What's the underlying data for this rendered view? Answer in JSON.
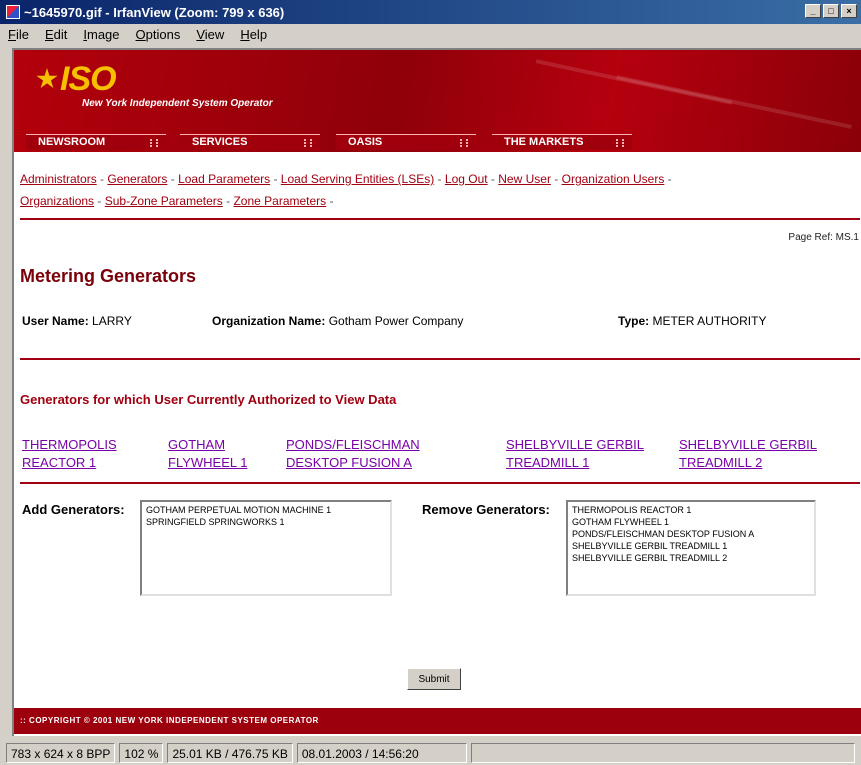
{
  "window": {
    "title": "~1645970.gif - IrfanView (Zoom: 799 x 636)",
    "menu": [
      "File",
      "Edit",
      "Image",
      "Options",
      "View",
      "Help"
    ]
  },
  "banner": {
    "logo": "ISO",
    "subtitle": "New York Independent System Operator",
    "tabs": [
      "NEWSROOM",
      "SERVICES",
      "OASIS",
      "THE MARKETS"
    ]
  },
  "nav_links": {
    "row1": [
      "Administrators",
      "Generators",
      "Load Parameters",
      "Load Serving Entities (LSEs)",
      "Log Out",
      "New User",
      "Organization Users"
    ],
    "row2": [
      "Organizations",
      "Sub-Zone Parameters",
      "Zone Parameters"
    ]
  },
  "page": {
    "page_ref": "Page Ref: MS.1",
    "title": "Metering Generators",
    "user_name_label": "User Name:",
    "user_name": "LARRY",
    "org_name_label": "Organization Name:",
    "org_name": "Gotham Power Company",
    "type_label": "Type:",
    "type": "METER AUTHORITY",
    "authorized_heading": "Generators for which User Currently Authorized to View Data",
    "authorized_generators": [
      {
        "line1": "THERMOPOLIS",
        "line2": "REACTOR 1"
      },
      {
        "line1": "GOTHAM",
        "line2": "FLYWHEEL 1"
      },
      {
        "line1": "PONDS/FLEISCHMAN",
        "line2": "DESKTOP FUSION A"
      },
      {
        "line1": "SHELBYVILLE GERBIL",
        "line2": "TREADMILL 1"
      },
      {
        "line1": "SHELBYVILLE GERBIL",
        "line2": "TREADMILL 2"
      }
    ],
    "add_label": "Add Generators:",
    "add_options": [
      "GOTHAM PERPETUAL MOTION MACHINE 1",
      "SPRINGFIELD SPRINGWORKS 1"
    ],
    "remove_label": "Remove Generators:",
    "remove_options": [
      "THERMOPOLIS REACTOR 1",
      "GOTHAM FLYWHEEL 1",
      "PONDS/FLEISCHMAN DESKTOP FUSION A",
      "SHELBYVILLE GERBIL TREADMILL 1",
      "SHELBYVILLE GERBIL TREADMILL 2"
    ],
    "submit_label": "Submit",
    "footer": ":: COPYRIGHT © 2001 NEW YORK INDEPENDENT SYSTEM OPERATOR"
  },
  "status_bar": [
    "783 x 624 x 8 BPP",
    "102 %",
    "25.01 KB / 476.75 KB",
    "08.01.2003 / 14:56:20"
  ],
  "colors": {
    "brand_red": "#a00010",
    "link_purple": "#7a00a8",
    "logo_yellow": "#f6c000"
  }
}
